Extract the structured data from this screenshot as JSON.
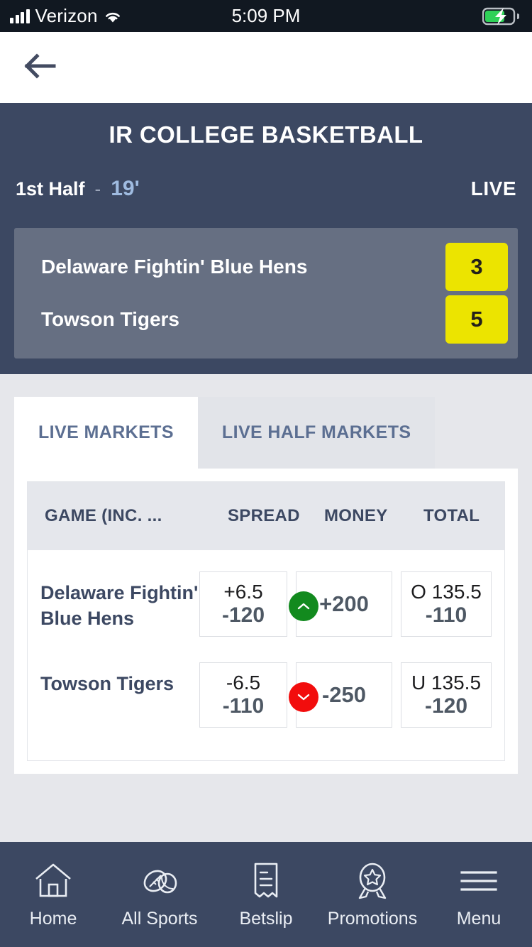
{
  "status_bar": {
    "carrier": "Verizon",
    "time": "5:09 PM",
    "signal_icon": "cellular-bars-icon",
    "wifi_icon": "wifi-icon",
    "battery_icon": "battery-charging-icon"
  },
  "nav": {
    "back_icon": "back-arrow-icon"
  },
  "event": {
    "title": "IR COLLEGE BASKETBALL",
    "period": "1st Half",
    "separator": "-",
    "clock": "19'",
    "live_label": "LIVE",
    "teams": [
      {
        "name": "Delaware Fightin' Blue Hens",
        "score": "3"
      },
      {
        "name": "Towson Tigers",
        "score": "5"
      }
    ]
  },
  "tabs": [
    {
      "label": "LIVE MARKETS",
      "active": true
    },
    {
      "label": "LIVE HALF MARKETS",
      "active": false
    }
  ],
  "market_table": {
    "headers": {
      "game": "GAME (INC. ...",
      "spread": "SPREAD",
      "money": "MONEY",
      "total": "TOTAL"
    },
    "rows": [
      {
        "team": "Delaware Fightin' Blue Hens",
        "spread": {
          "line": "+6.5",
          "price": "-120"
        },
        "money": {
          "price": "+200",
          "movement": "up",
          "movement_icon": "chevron-up-icon"
        },
        "total": {
          "line": "O 135.5",
          "price": "-110"
        }
      },
      {
        "team": "Towson Tigers",
        "spread": {
          "line": "-6.5",
          "price": "-110"
        },
        "money": {
          "price": "-250",
          "movement": "down",
          "movement_icon": "chevron-down-icon"
        },
        "total": {
          "line": "U 135.5",
          "price": "-120"
        }
      }
    ]
  },
  "bottom_nav": [
    {
      "label": "Home",
      "icon": "home-icon"
    },
    {
      "label": "All Sports",
      "icon": "sports-balls-icon"
    },
    {
      "label": "Betslip",
      "icon": "receipt-icon"
    },
    {
      "label": "Promotions",
      "icon": "award-ribbon-icon"
    },
    {
      "label": "Menu",
      "icon": "hamburger-menu-icon"
    }
  ],
  "colors": {
    "header_navy": "#3c4862",
    "scoreboard_slate": "#666f82",
    "score_yellow": "#ece400",
    "page_bg": "#e6e7eb",
    "tab_text": "#5c6f92",
    "up_green": "#128a1e",
    "down_red": "#f20d0d",
    "clock_blue": "#9fbbe0"
  }
}
